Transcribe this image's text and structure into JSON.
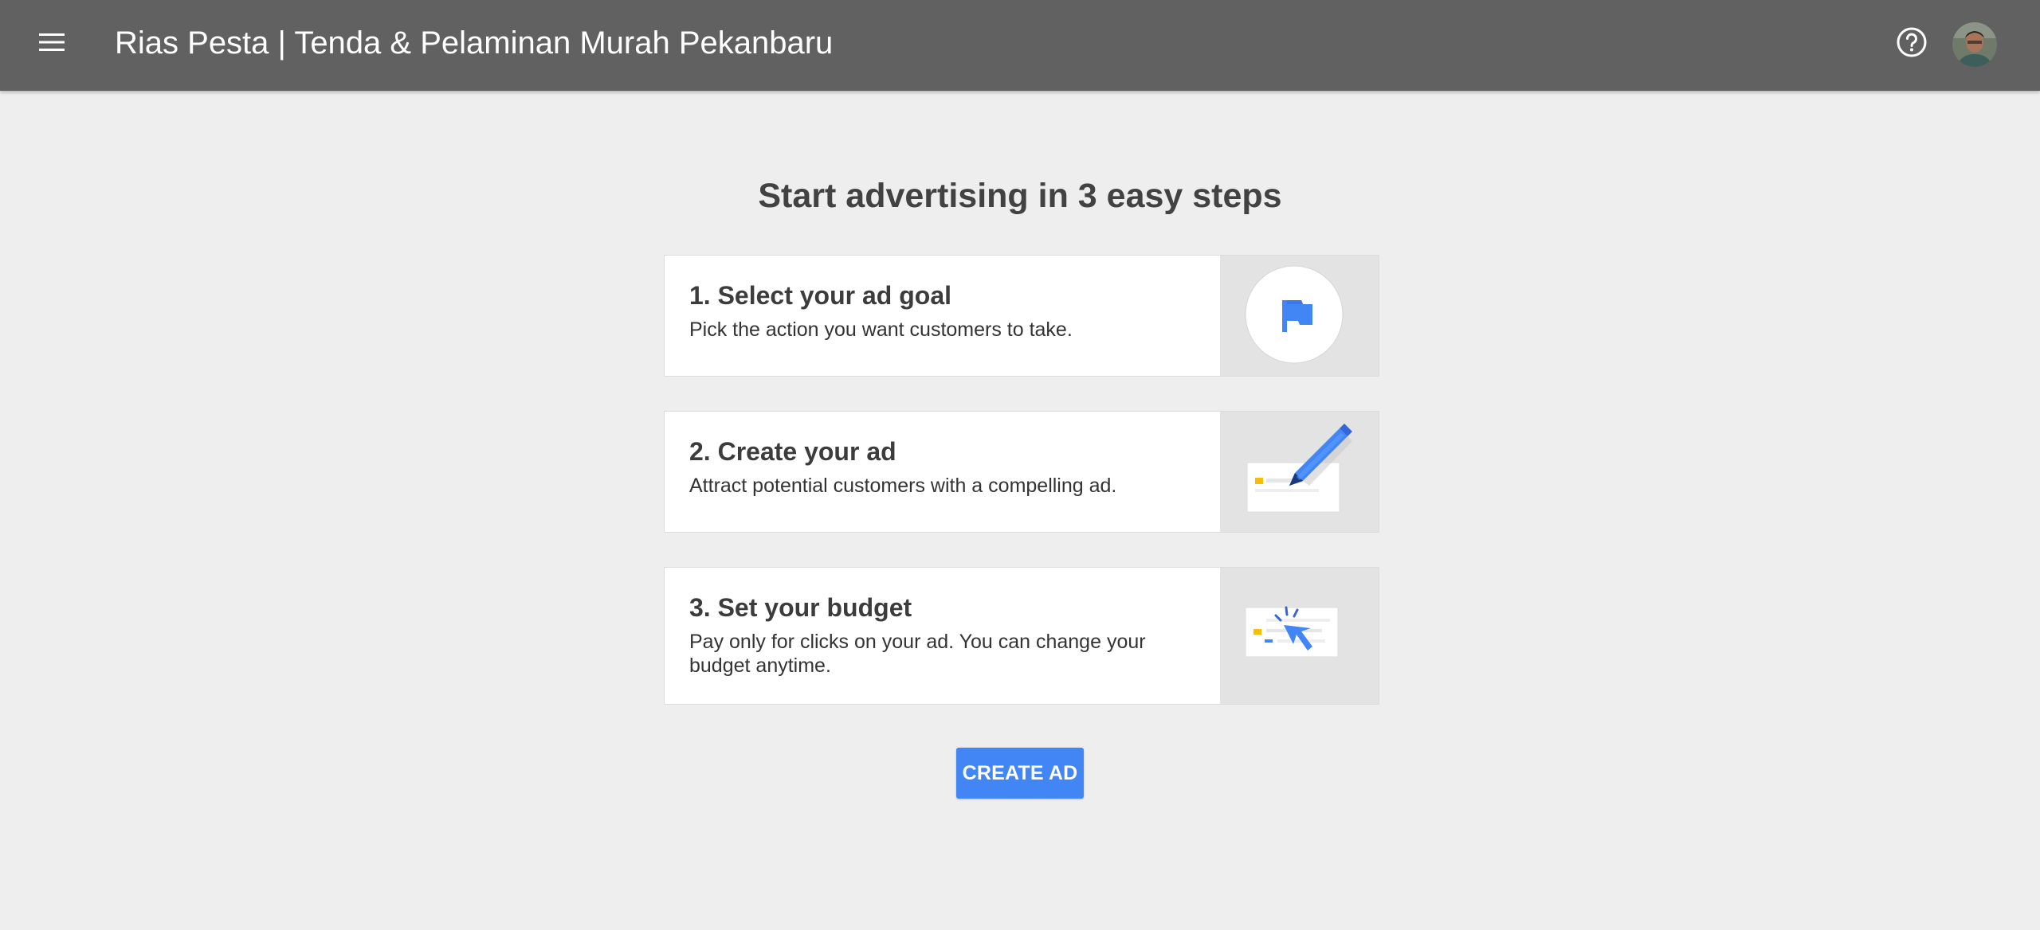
{
  "header": {
    "title": "Rias Pesta | Tenda & Pelaminan Murah Pekanbaru",
    "menu_icon": "menu-icon",
    "help_icon": "help-circle-icon",
    "avatar": "user-avatar"
  },
  "main": {
    "heading": "Start advertising in 3 easy steps",
    "steps": [
      {
        "title": "1. Select your ad goal",
        "description": "Pick the action you want customers to take.",
        "icon": "flag-icon"
      },
      {
        "title": "2. Create your ad",
        "description": "Attract potential customers with a compelling ad.",
        "icon": "pencil-ad-icon"
      },
      {
        "title": "3. Set your budget",
        "description": "Pay only for clicks on your ad. You can change your budget anytime.",
        "icon": "cursor-click-icon"
      }
    ],
    "cta_label": "CREATE AD"
  },
  "colors": {
    "topbar": "#616161",
    "background": "#eeeeee",
    "accent": "#4285f4",
    "highlight": "#fbbc04"
  }
}
